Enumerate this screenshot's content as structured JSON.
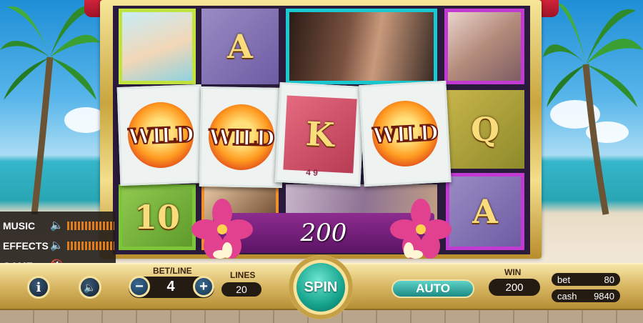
{
  "sound_panel": {
    "music_label": "MUSIC",
    "effects_label": "EFFECTS",
    "game_label": "GAME"
  },
  "reels": {
    "row1": [
      "photo-woman-beach",
      "A",
      "photo-woman-hair",
      "photo-woman-chair"
    ],
    "row2": [
      "WILD",
      "WILD",
      "K",
      "WILD",
      "Q"
    ],
    "row3": [
      "10",
      "photo",
      "photo",
      "A"
    ],
    "wild_label": "WILD",
    "k_card": "K",
    "small_badge": "4 9",
    "q_card": "Q",
    "a_card_top": "A",
    "ten_card": "10",
    "a_card_bottom": "A"
  },
  "win_banner": "200",
  "controls": {
    "info_icon": "i",
    "bet_line_label": "BET/LINE",
    "bet_line_value": "4",
    "minus": "−",
    "plus": "+",
    "lines_label": "LINES",
    "lines_value": "20",
    "spin_label": "SPIN",
    "auto_label": "AUTO",
    "win_label": "WIN",
    "win_value": "200",
    "bet_label": "bet",
    "bet_value": "80",
    "cash_label": "cash",
    "cash_value": "9840"
  },
  "icons": [
    "info-icon",
    "speaker-icon",
    "speaker-muted-icon",
    "minus-icon",
    "plus-icon"
  ]
}
